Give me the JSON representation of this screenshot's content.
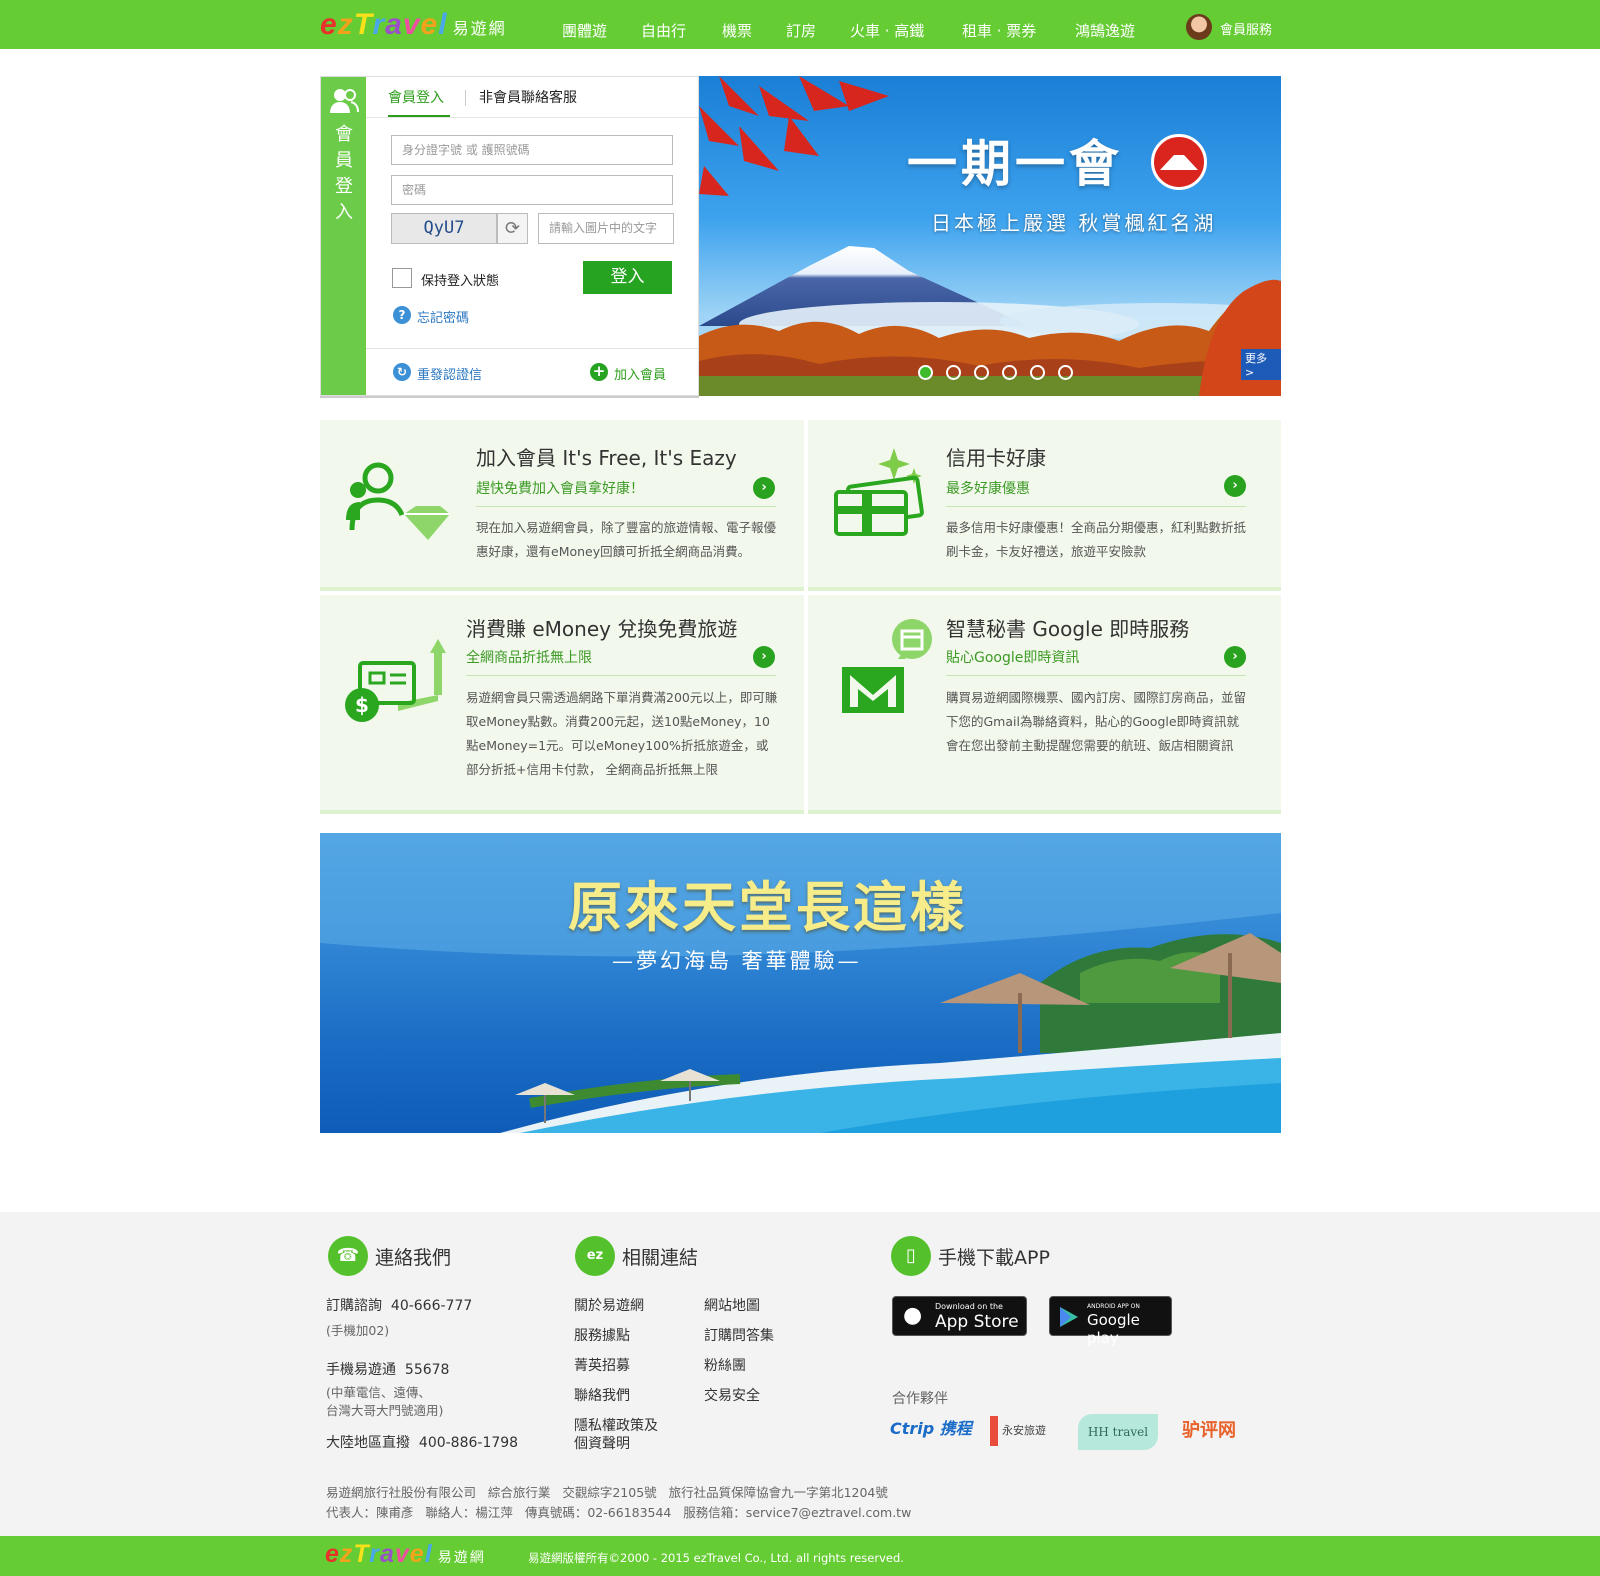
{
  "brand": {
    "logo_text": "ezTravel",
    "logo_cn": "易遊網"
  },
  "nav": {
    "items": [
      "團體遊",
      "自由行",
      "機票",
      "訂房",
      "火車 · 高鐵",
      "租車 · 票券",
      "鴻鵠逸遊"
    ],
    "member_service": "會員服務"
  },
  "login": {
    "side_label": [
      "會",
      "員",
      "登",
      "入"
    ],
    "tab_member": "會員登入",
    "tab_guest": "非會員聯絡客服",
    "id_placeholder": "身分證字號 或 護照號碼",
    "password_placeholder": "密碼",
    "captcha_text": "QyU7",
    "captcha_placeholder": "請輸入圖片中的文字",
    "remember_label": "保持登入狀態",
    "login_button": "登入",
    "forgot_password": "忘記密碼",
    "resend_verification": "重發認證信",
    "join_member": "加入會員"
  },
  "hero": {
    "title": "一期一會",
    "subtitle": "日本極上嚴選 秋賞楓紅名湖",
    "more": "更多 >",
    "dots": 6,
    "active_dot": 0
  },
  "features": [
    {
      "title": "加入會員 It's Free, It's Eazy",
      "subtitle": "趕快免費加入會員拿好康！",
      "desc": "現在加入易遊網會員，除了豐富的旅遊情報、電子報優惠好康，還有eMoney回饋可折抵全網商品消費。",
      "icon": "member-diamond-icon"
    },
    {
      "title": "信用卡好康",
      "subtitle": "最多好康優惠",
      "desc": "最多信用卡好康優惠！全商品分期優惠，紅利點數折抵刷卡金，卡友好禮送，旅遊平安險款",
      "icon": "gift-card-icon"
    },
    {
      "title": "消費賺 eMoney 兌換免費旅遊",
      "subtitle": "全網商品折抵無上限",
      "desc": "易遊網會員只需透過網路下單消費滿200元以上，即可賺取eMoney點數。消費200元起，送10點eMoney，10點eMoney=1元。可以eMoney100%折抵旅遊金，或部分折抵+信用卡付款，  全網商品折抵無上限",
      "icon": "emoney-icon"
    },
    {
      "title": "智慧秘書 Google 即時服務",
      "subtitle": "貼心Google即時資訊",
      "desc": "購買易遊網國際機票、國內訂房、國際訂房商品，並留下您的Gmail為聯絡資料，貼心的Google即時資訊就會在您出發前主動提醒您需要的航班、飯店相關資訊",
      "icon": "gmail-calendar-icon"
    }
  ],
  "banner2": {
    "title": "原來天堂長這樣",
    "subtitle": "—夢幻海島  奢華體驗—"
  },
  "footer": {
    "contact": {
      "heading": "連絡我們",
      "order_label": "訂購諮詢",
      "order_number": "40-666-777",
      "order_note": "(手機加02)",
      "mobile_label": "手機易遊通",
      "mobile_number": "55678",
      "mobile_note_1": "(中華電信、遠傳、",
      "mobile_note_2": "台灣大哥大門號適用)",
      "china_label": "大陸地區直撥",
      "china_number": "400-886-1798"
    },
    "links": {
      "heading": "相關連結",
      "col1": [
        "關於易遊網",
        "服務據點",
        "菁英招募",
        "聯絡我們",
        "隱私權政策及",
        "個資聲明"
      ],
      "col2": [
        "網站地圖",
        "訂購問答集",
        "粉絲團",
        "交易安全"
      ]
    },
    "app": {
      "heading": "手機下載APP",
      "appstore_small": "Download on the",
      "appstore_big": "App Store",
      "gplay_small": "ANDROID APP ON",
      "gplay_big": "Google play",
      "partners_label": "合作夥伴",
      "partners": [
        "Ctrip 携程",
        "永安旅遊",
        "HH travel",
        "驴评网"
      ]
    },
    "company_line1": "易遊網旅行社股份有限公司   綜合旅行業   交觀綜字2105號   旅行社品質保障協會九一字第北1204號",
    "company_line2": "代表人：陳甫彥   聯絡人：楊江萍   傳真號碼：02-66183544   服務信箱：service7@eztravel.com.tw",
    "copyright": "易遊網版權所有©2000 - 2015 ezTravel Co., Ltd. all rights reserved."
  },
  "colors": {
    "brand_green": "#66cc33",
    "dark_green": "#27a322",
    "link_blue": "#2b77c0"
  }
}
